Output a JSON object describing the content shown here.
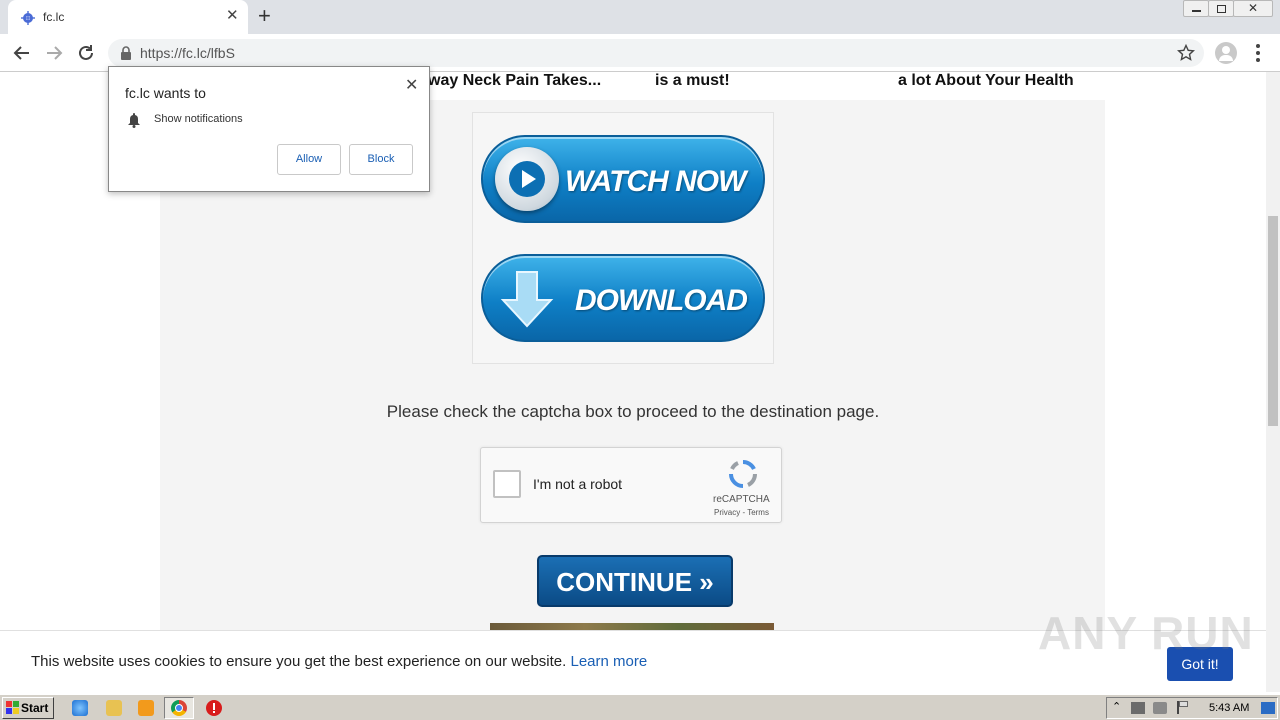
{
  "browser": {
    "tab_title": "fc.lc",
    "url": "https://fc.lc/lfbS"
  },
  "page": {
    "headlines": [
      "way Neck Pain Takes...",
      "is a must!",
      "a lot About Your Health"
    ],
    "watch_now_label": "WATCH NOW",
    "download_label": "DOWNLOAD",
    "captcha_message": "Please check the captcha box to proceed to the destination page.",
    "recaptcha": {
      "checkbox_label": "I'm not a robot",
      "brand": "reCAPTCHA",
      "links": "Privacy - Terms"
    },
    "continue_label": "CONTINUE »"
  },
  "notification": {
    "title": "fc.lc wants to",
    "permission": "Show notifications",
    "allow_label": "Allow",
    "block_label": "Block"
  },
  "cookie_bar": {
    "text": "This website uses cookies to ensure you get the best experience on our website.",
    "link": "Learn more",
    "button": "Got it!"
  },
  "watermark": "ANY RUN",
  "taskbar": {
    "start_label": "Start",
    "clock": "5:43 AM"
  },
  "colors": {
    "accent_blue": "#0e7fc6",
    "got_it_blue": "#1a4fb0",
    "link_blue": "#1a5fb4"
  }
}
